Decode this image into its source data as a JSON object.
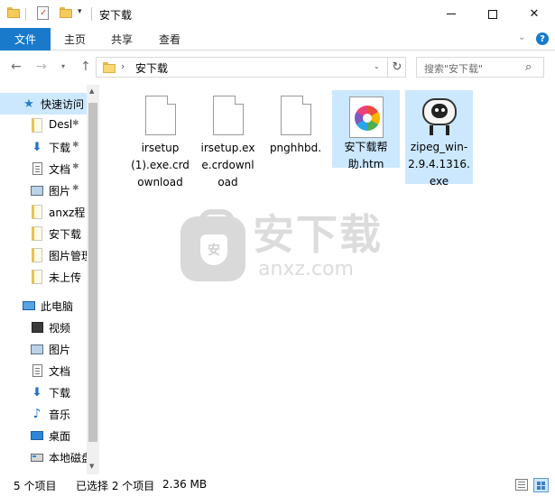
{
  "window": {
    "title": "安下载",
    "minimize_glyph": "—",
    "maximize_glyph": "☐",
    "close_glyph": "✕"
  },
  "quick_access_toolbar": {
    "dropdown_glyph": "▾"
  },
  "ribbon": {
    "file_tab": "文件",
    "tabs": [
      "主页",
      "共享",
      "查看"
    ],
    "expand_glyph": "⌄",
    "help_glyph": "?"
  },
  "navigation": {
    "back_glyph": "←",
    "forward_glyph": "→",
    "recent_glyph": "▾",
    "up_glyph": "↑",
    "address_chevron": "›",
    "address": "安下载",
    "address_dropdown_glyph": "⌄",
    "refresh_glyph": "↻",
    "search_placeholder": "搜索\"安下载\"",
    "search_icon_glyph": "⌕"
  },
  "sidebar": {
    "items": [
      {
        "label": "快速访问",
        "icon": "star-icon",
        "pinned": false,
        "selected": true
      },
      {
        "label": "Desl",
        "icon": "folder-icon",
        "pinned": true
      },
      {
        "label": "下载",
        "icon": "download-icon",
        "pinned": true
      },
      {
        "label": "文档",
        "icon": "document-icon",
        "pinned": true
      },
      {
        "label": "图片",
        "icon": "picture-icon",
        "pinned": true
      },
      {
        "label": "anxz程",
        "icon": "folder-icon",
        "pinned": false
      },
      {
        "label": "安下载",
        "icon": "folder-icon",
        "pinned": false
      },
      {
        "label": "图片管理",
        "icon": "folder-icon",
        "pinned": false
      },
      {
        "label": "未上传",
        "icon": "folder-icon",
        "pinned": false
      },
      {
        "label": "此电脑",
        "icon": "computer-icon",
        "pinned": false
      },
      {
        "label": "视频",
        "icon": "video-icon",
        "pinned": false
      },
      {
        "label": "图片",
        "icon": "picture-icon",
        "pinned": false
      },
      {
        "label": "文档",
        "icon": "document-icon",
        "pinned": false
      },
      {
        "label": "下载",
        "icon": "download-icon",
        "pinned": false
      },
      {
        "label": "音乐",
        "icon": "music-icon",
        "pinned": false
      },
      {
        "label": "桌面",
        "icon": "desktop-icon",
        "pinned": false
      },
      {
        "label": "本地磁盘",
        "icon": "local-disk-icon",
        "pinned": false
      }
    ],
    "pin_glyph": "📌",
    "download_glyph": "⬇",
    "music_glyph": "♪",
    "star_glyph": "★",
    "scroll_up_glyph": "▲",
    "scroll_down_glyph": "▼"
  },
  "files": [
    {
      "name": "irsetup (1).exe.crdownload",
      "label_lines": [
        "irsetup",
        "(1).exe.crd",
        "ownload"
      ],
      "icon": "blank-file-icon",
      "selected": false
    },
    {
      "name": "irsetup.exe.crdownload",
      "label_lines": [
        "irsetup.ex",
        "e.crdownl",
        "oad"
      ],
      "icon": "blank-file-icon",
      "selected": false
    },
    {
      "name": "pnghhbd.",
      "label_lines": [
        "pnghhbd."
      ],
      "icon": "blank-file-icon",
      "selected": false
    },
    {
      "name": "安下载帮助.htm",
      "label_lines": [
        "安下载帮",
        "助.htm"
      ],
      "icon": "pinwheel-htm-icon",
      "selected": true
    },
    {
      "name": "zipeg_win-2.9.4.1316.exe",
      "label_lines": [
        "zipeg_win-",
        "2.9.4.1316.",
        "exe"
      ],
      "icon": "sheep-exe-icon",
      "selected": true
    }
  ],
  "watermark": {
    "brand_cn": "安下载",
    "brand_en": "anxz.com",
    "badge_char": "安"
  },
  "statusbar": {
    "item_count": "5 个项目",
    "selection": "已选择 2 个项目",
    "size": "2.36 MB"
  },
  "colors": {
    "accent": "#1979ca",
    "selection": "#cce8ff",
    "watermark": "#dcdcdc"
  }
}
